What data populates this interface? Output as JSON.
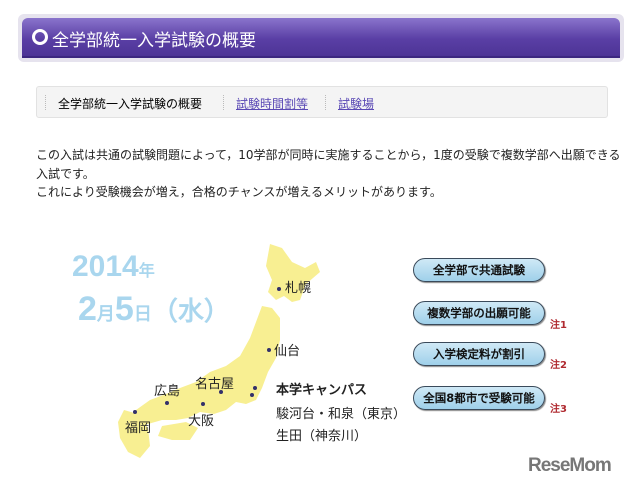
{
  "header": {
    "title": "全学部統一入学試験の概要"
  },
  "tabs": [
    {
      "label": "全学部統一入学試験の概要"
    },
    {
      "label": "試験時間割等"
    },
    {
      "label": "試験場"
    }
  ],
  "intro": {
    "line1": "この入試は共通の試験問題によって，10学部が同時に実施することから，1度の受験で複数学部へ出願できる入試です。",
    "line2": "これにより受験機会が増え，合格のチャンスが増えるメリットがあります。"
  },
  "exam_date": {
    "year": "2014",
    "year_unit": "年",
    "month": "2",
    "month_unit": "月",
    "day": "5",
    "day_unit": "日",
    "weekday": "（水）"
  },
  "map": {
    "cities": {
      "sapporo": "札幌",
      "sendai": "仙台",
      "nagoya": "名古屋",
      "hiroshima": "広島",
      "osaka": "大阪",
      "fukuoka": "福岡"
    },
    "campus": {
      "title": "本学キャンパス",
      "line1": "駿河台・和泉（東京）",
      "line2": "生田（神奈川）"
    }
  },
  "features": [
    {
      "label": "全学部で共通試験",
      "note": ""
    },
    {
      "label": "複数学部の出願可能",
      "note": "注1"
    },
    {
      "label": "入学検定料が割引",
      "note": "注2"
    },
    {
      "label": "全国8都市で受験可能",
      "note": "注3"
    }
  ],
  "watermark": "ReseMom"
}
